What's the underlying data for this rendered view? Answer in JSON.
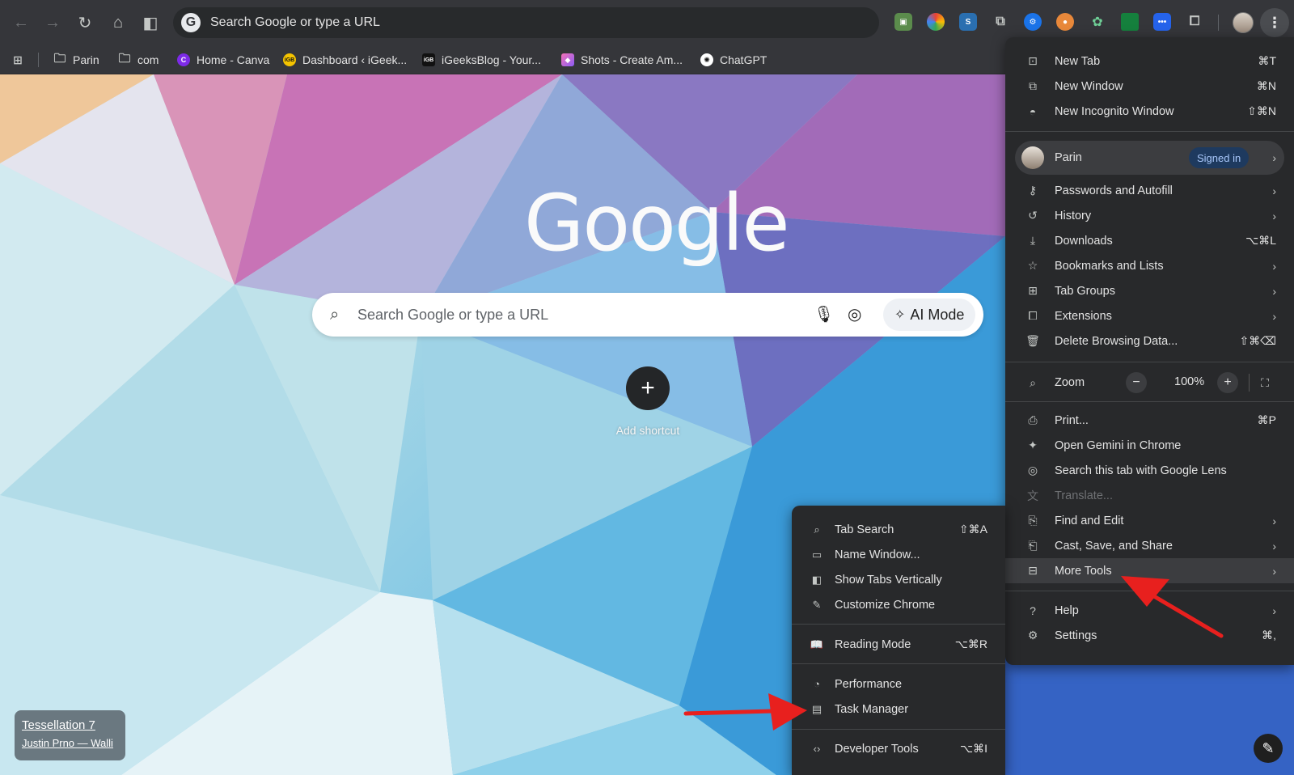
{
  "toolbar": {
    "omnibox_text": "Search Google or type a URL",
    "omnibox_icon_letter": "G",
    "menu_glyph": "⋮"
  },
  "bookmarks": [
    {
      "label": "Parin",
      "icon": "folder-icon"
    },
    {
      "label": "com",
      "icon": "folder-icon"
    },
    {
      "label": "Home - Canva",
      "icon": "canva-icon"
    },
    {
      "label": "Dashboard ‹ iGeek...",
      "icon": "igeeks-icon"
    },
    {
      "label": "iGeeksBlog - Your...",
      "icon": "igb-icon"
    },
    {
      "label": "Shots - Create Am...",
      "icon": "shots-icon"
    },
    {
      "label": "ChatGPT",
      "icon": "chatgpt-icon"
    }
  ],
  "ntp": {
    "logo": "Google",
    "search_placeholder": "Search Google or type a URL",
    "ai_mode_label": "AI Mode",
    "add_shortcut_label": "Add shortcut",
    "attribution_title": "Tessellation 7",
    "attribution_author": "Justin Prno — Walli"
  },
  "menu": {
    "new_tab": {
      "label": "New Tab",
      "shortcut": "⌘T"
    },
    "new_window": {
      "label": "New Window",
      "shortcut": "⌘N"
    },
    "new_incognito": {
      "label": "New Incognito Window",
      "shortcut": "⇧⌘N"
    },
    "profile": {
      "name": "Parin",
      "status": "Signed in"
    },
    "passwords": {
      "label": "Passwords and Autofill"
    },
    "history": {
      "label": "History"
    },
    "downloads": {
      "label": "Downloads",
      "shortcut": "⌥⌘L"
    },
    "bookmarks": {
      "label": "Bookmarks and Lists"
    },
    "tab_groups": {
      "label": "Tab Groups"
    },
    "extensions": {
      "label": "Extensions"
    },
    "delete_data": {
      "label": "Delete Browsing Data...",
      "shortcut": "⇧⌘⌫"
    },
    "zoom": {
      "label": "Zoom",
      "value": "100%",
      "minus": "−",
      "plus": "+"
    },
    "print": {
      "label": "Print...",
      "shortcut": "⌘P"
    },
    "gemini": {
      "label": "Open Gemini in Chrome"
    },
    "lens": {
      "label": "Search this tab with Google Lens"
    },
    "translate": {
      "label": "Translate..."
    },
    "find_edit": {
      "label": "Find and Edit"
    },
    "cast_save": {
      "label": "Cast, Save, and Share"
    },
    "more_tools": {
      "label": "More Tools"
    },
    "help": {
      "label": "Help"
    },
    "settings": {
      "label": "Settings",
      "shortcut": "⌘,"
    }
  },
  "submenu": {
    "tab_search": {
      "label": "Tab Search",
      "shortcut": "⇧⌘A"
    },
    "name_window": {
      "label": "Name Window..."
    },
    "show_tabs_vertically": {
      "label": "Show Tabs Vertically"
    },
    "customize_chrome": {
      "label": "Customize Chrome"
    },
    "reading_mode": {
      "label": "Reading Mode",
      "shortcut": "⌥⌘R"
    },
    "performance": {
      "label": "Performance"
    },
    "task_manager": {
      "label": "Task Manager"
    },
    "developer_tools": {
      "label": "Developer Tools",
      "shortcut": "⌥⌘I"
    }
  },
  "colors": {
    "toolbar_bg": "#35363a",
    "menu_bg": "#28292b",
    "badge_bg": "#1e3a5f",
    "badge_text": "#a8c7fa",
    "annotation_arrow": "#e8201e"
  }
}
